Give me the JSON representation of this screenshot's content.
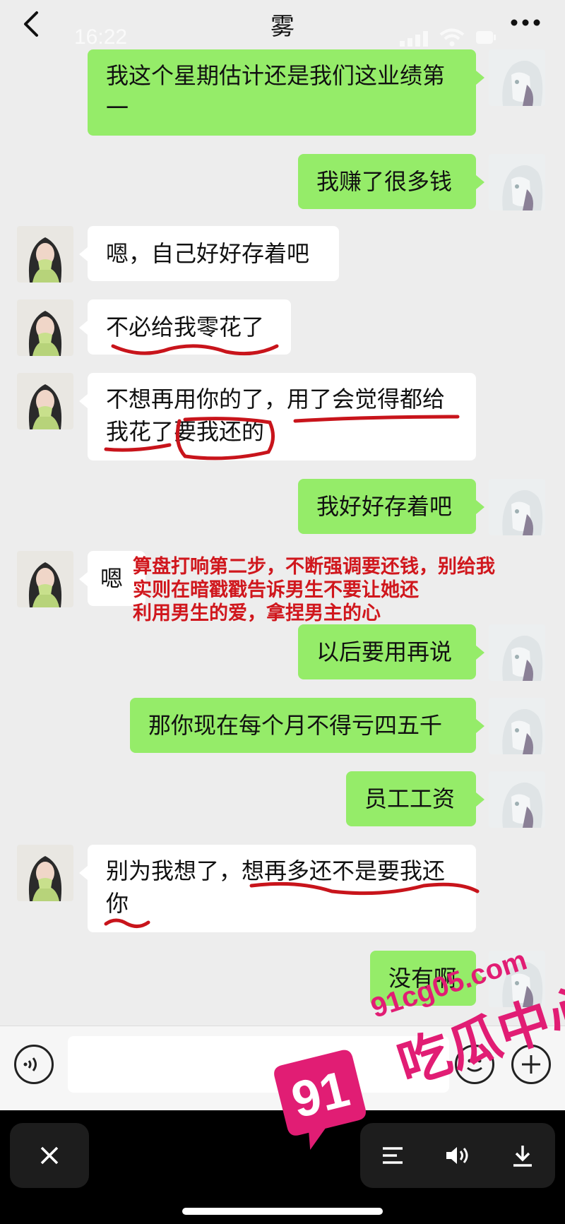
{
  "header": {
    "title": "雾",
    "status_time": "16:22"
  },
  "messages": [
    {
      "side": "right",
      "lines": [
        "我这个星期估计还是我们这业绩第",
        "一"
      ]
    },
    {
      "side": "right",
      "lines": [
        "我赚了很多钱"
      ]
    },
    {
      "side": "left",
      "lines": [
        "嗯，自己好好存着吧"
      ]
    },
    {
      "side": "left",
      "lines": [
        "不必给我零花了"
      ]
    },
    {
      "side": "left",
      "lines": [
        "不想再用你的了，用了会觉得都给",
        "我花了要我还的"
      ]
    },
    {
      "side": "right",
      "lines": [
        "我好好存着吧"
      ]
    },
    {
      "side": "left",
      "lines": [
        "嗯"
      ]
    },
    {
      "side": "right",
      "lines": [
        "以后要用再说"
      ]
    },
    {
      "side": "right",
      "lines": [
        "那你现在每个月不得亏四五千"
      ]
    },
    {
      "side": "right",
      "lines": [
        "员工工资"
      ]
    },
    {
      "side": "left",
      "lines": [
        "别为我想了，想再多还不是要我还",
        "你"
      ]
    },
    {
      "side": "right",
      "lines": [
        "没有啊"
      ]
    }
  ],
  "annotation": {
    "lines": [
      "算盘打响第二步，不断强调要还钱，别给我",
      "实则在暗戳戳告诉男生不要让她还",
      "利用男生的爱，拿捏男主的心"
    ],
    "color": "#d0171d"
  },
  "input": {
    "value": ""
  },
  "watermark": {
    "domain": "91cg05.com",
    "brand_cn": "吃瓜中心",
    "badge": "91",
    "color": "#e11d74"
  },
  "colors": {
    "chat_bg": "#ededed",
    "bubble_right": "#95ec69",
    "bubble_left": "#ffffff"
  },
  "icons": {
    "back": "back-chevron-icon",
    "more": "more-dots-icon",
    "voice": "voice-icon",
    "emoji": "emoji-icon",
    "plus": "plus-icon",
    "close": "close-icon",
    "list": "list-icon",
    "sound": "speaker-icon",
    "download": "download-icon"
  }
}
